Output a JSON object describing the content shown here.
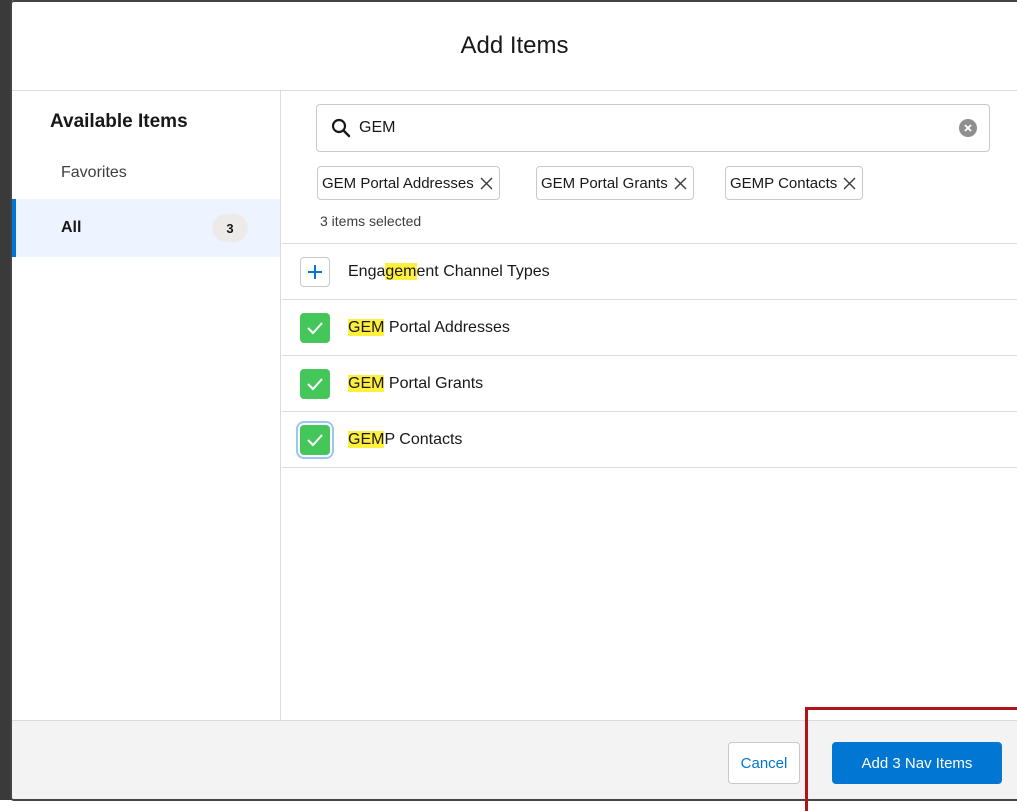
{
  "modal": {
    "title": "Add Items"
  },
  "sidebar": {
    "heading": "Available Items",
    "items": [
      {
        "label": "Favorites",
        "count": ""
      },
      {
        "label": "All",
        "count": "3"
      }
    ]
  },
  "search": {
    "value": "GEM",
    "placeholder": ""
  },
  "selected": {
    "pills": [
      "GEM Portal Addresses",
      "GEM Portal Grants",
      "GEMP Contacts"
    ],
    "count_text": "3 items selected"
  },
  "results": [
    {
      "pre": "Enga",
      "match": "gem",
      "post": "ent Channel Types",
      "state": "add"
    },
    {
      "pre": "",
      "match": "GEM",
      "post": " Portal Addresses",
      "state": "checked"
    },
    {
      "pre": "",
      "match": "GEM",
      "post": " Portal Grants",
      "state": "checked"
    },
    {
      "pre": "",
      "match": "GEM",
      "post": "P Contacts",
      "state": "checked"
    }
  ],
  "footer": {
    "cancel_label": "Cancel",
    "submit_label": "Add 3 Nav Items"
  },
  "colors": {
    "brand": "#0176d3",
    "checked": "#45c65a",
    "highlight": "#fff03f",
    "annotation": "#b0141a"
  },
  "icons": {
    "search": "search-icon",
    "clear": "clear-icon",
    "remove": "close-icon",
    "add": "plus-icon",
    "checked": "checkmark-icon"
  }
}
